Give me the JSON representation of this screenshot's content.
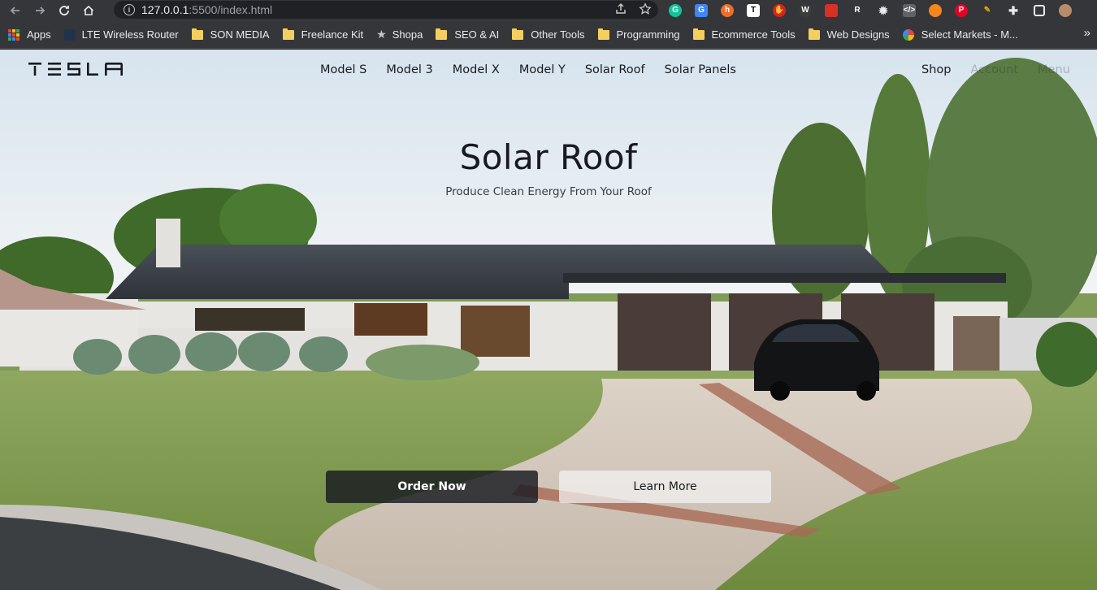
{
  "browser": {
    "url_host": "127.0.0.1",
    "url_path": ":5500/index.html",
    "bookmarks": [
      {
        "label": "Apps",
        "icon": "apps-grid-icon"
      },
      {
        "label": "LTE Wireless Router",
        "icon": "router-icon"
      },
      {
        "label": "SON MEDIA",
        "icon": "folder-icon"
      },
      {
        "label": "Freelance Kit",
        "icon": "folder-icon"
      },
      {
        "label": "Shopa",
        "icon": "star-icon"
      },
      {
        "label": "SEO & AI",
        "icon": "folder-icon"
      },
      {
        "label": "Other Tools",
        "icon": "folder-icon"
      },
      {
        "label": "Programming",
        "icon": "folder-icon"
      },
      {
        "label": "Ecommerce Tools",
        "icon": "folder-icon"
      },
      {
        "label": "Web Designs",
        "icon": "folder-icon"
      },
      {
        "label": "Select Markets - M...",
        "icon": "google-icon"
      }
    ],
    "overflow": "»"
  },
  "site": {
    "logo_alt": "TESLA",
    "nav": [
      "Model S",
      "Model 3",
      "Model X",
      "Model Y",
      "Solar Roof",
      "Solar Panels"
    ],
    "right_nav": [
      "Shop",
      "Account",
      "Menu"
    ]
  },
  "hero": {
    "title": "Solar Roof",
    "subtitle": "Produce Clean Energy From Your Roof",
    "primary_button": "Order Now",
    "secondary_button": "Learn More"
  },
  "colors": {
    "text_dark": "#171a20",
    "button_dark": "#171a20",
    "button_light": "#f4f4f4",
    "chrome_bg": "#35363a"
  }
}
